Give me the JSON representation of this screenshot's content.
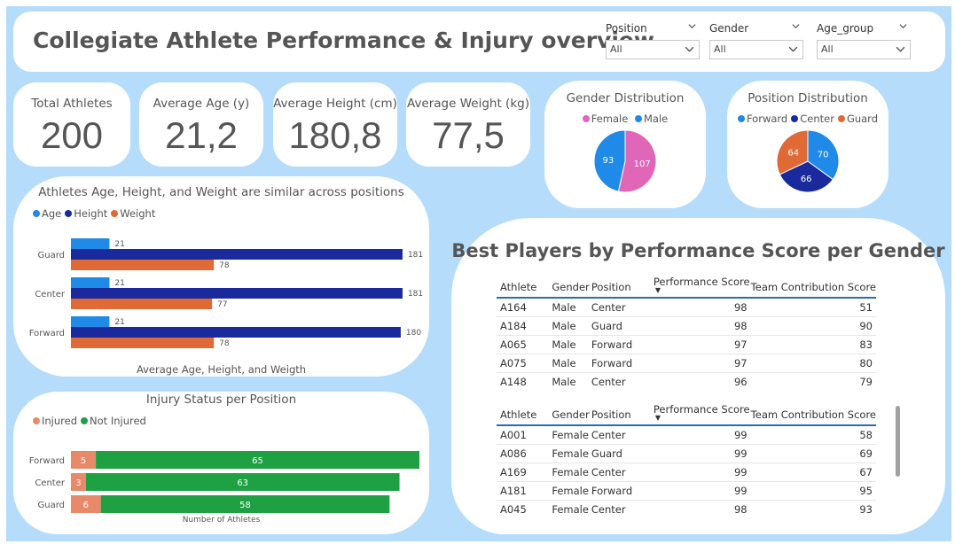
{
  "header": {
    "title": "Collegiate Athlete Performance & Injury overview",
    "slicers": [
      {
        "label": "Position",
        "value": "All"
      },
      {
        "label": "Gender",
        "value": "All"
      },
      {
        "label": "Age_group",
        "value": "All"
      }
    ]
  },
  "kpis": [
    {
      "label": "Total Athletes",
      "value": "200"
    },
    {
      "label": "Average Age (y)",
      "value": "21,2"
    },
    {
      "label": "Average Height (cm)",
      "value": "180,8"
    },
    {
      "label": "Average Weight (kg)",
      "value": "77,5"
    }
  ],
  "gender_pie": {
    "title": "Gender Distribution",
    "legend": [
      "Female",
      "Male"
    ],
    "colors": [
      "#e066b8",
      "#1f8ae8"
    ],
    "values": [
      107,
      93
    ],
    "labels": [
      "107",
      "93"
    ]
  },
  "position_pie": {
    "title": "Position Distribution",
    "legend": [
      "Forward",
      "Center",
      "Guard"
    ],
    "colors": [
      "#1f8ae8",
      "#1a2a9c",
      "#e06a36"
    ],
    "values": [
      70,
      66,
      64
    ],
    "labels": [
      "70",
      "66",
      "64"
    ]
  },
  "bar_chart": {
    "title": "Athletes Age, Height, and Weight are similar across positions",
    "legend": [
      "Age",
      "Height",
      "Weight"
    ],
    "colors": [
      "#1f8ae8",
      "#1a2a9c",
      "#e06a36"
    ],
    "xlabel": "Average Age, Height, and Weigth",
    "categories": [
      "Guard",
      "Center",
      "Forward"
    ],
    "series": [
      {
        "name": "Age",
        "values": [
          21,
          21,
          21
        ],
        "labels": [
          "21",
          "21",
          "21"
        ]
      },
      {
        "name": "Height",
        "values": [
          181,
          181,
          180
        ],
        "labels": [
          "181",
          "181",
          "180"
        ]
      },
      {
        "name": "Weight",
        "values": [
          78,
          77,
          78
        ],
        "labels": [
          "78",
          "77",
          "78"
        ]
      }
    ]
  },
  "injury_chart": {
    "title": "Injury Status per Position",
    "legend": [
      "Injured",
      "Not Injured"
    ],
    "colors": [
      "#e8896a",
      "#1ea043"
    ],
    "xlabel": "Number of Athletes",
    "categories": [
      "Forward",
      "Center",
      "Guard"
    ],
    "series": [
      {
        "name": "Injured",
        "values": [
          5,
          3,
          6
        ],
        "labels": [
          "5",
          "3",
          "6"
        ]
      },
      {
        "name": "Not Injured",
        "values": [
          65,
          63,
          58
        ],
        "labels": [
          "65",
          "63",
          "58"
        ]
      }
    ]
  },
  "best_players": {
    "title": "Best Players by Performance Score per Gender",
    "columns": [
      "Athlete",
      "Gender",
      "Position",
      "Performance Score",
      "Team Contribution Score"
    ],
    "male_rows": [
      [
        "A164",
        "Male",
        "Center",
        "98",
        "51"
      ],
      [
        "A184",
        "Male",
        "Guard",
        "98",
        "90"
      ],
      [
        "A065",
        "Male",
        "Forward",
        "97",
        "83"
      ],
      [
        "A075",
        "Male",
        "Forward",
        "97",
        "80"
      ],
      [
        "A148",
        "Male",
        "Center",
        "96",
        "79"
      ]
    ],
    "female_rows": [
      [
        "A001",
        "Female",
        "Center",
        "99",
        "58"
      ],
      [
        "A086",
        "Female",
        "Guard",
        "99",
        "69"
      ],
      [
        "A169",
        "Female",
        "Center",
        "99",
        "67"
      ],
      [
        "A181",
        "Female",
        "Forward",
        "99",
        "95"
      ],
      [
        "A045",
        "Female",
        "Center",
        "98",
        "93"
      ]
    ],
    "sort_indicator": "▼"
  },
  "chart_data": [
    {
      "type": "pie",
      "title": "Gender Distribution",
      "categories": [
        "Female",
        "Male"
      ],
      "values": [
        107,
        93
      ]
    },
    {
      "type": "pie",
      "title": "Position Distribution",
      "categories": [
        "Forward",
        "Center",
        "Guard"
      ],
      "values": [
        70,
        66,
        64
      ]
    },
    {
      "type": "bar",
      "title": "Athletes Age, Height, and Weight are similar across positions",
      "orientation": "horizontal",
      "categories": [
        "Guard",
        "Center",
        "Forward"
      ],
      "series": [
        {
          "name": "Age",
          "values": [
            21,
            21,
            21
          ]
        },
        {
          "name": "Height",
          "values": [
            181,
            181,
            180
          ]
        },
        {
          "name": "Weight",
          "values": [
            78,
            77,
            78
          ]
        }
      ],
      "xlabel": "Average Age, Height, and Weigth",
      "legend": "top-left"
    },
    {
      "type": "bar",
      "title": "Injury Status per Position",
      "orientation": "horizontal",
      "stacked": true,
      "categories": [
        "Forward",
        "Center",
        "Guard"
      ],
      "series": [
        {
          "name": "Injured",
          "values": [
            5,
            3,
            6
          ]
        },
        {
          "name": "Not Injured",
          "values": [
            65,
            63,
            58
          ]
        }
      ],
      "xlabel": "Number of Athletes",
      "legend": "top-left"
    }
  ]
}
